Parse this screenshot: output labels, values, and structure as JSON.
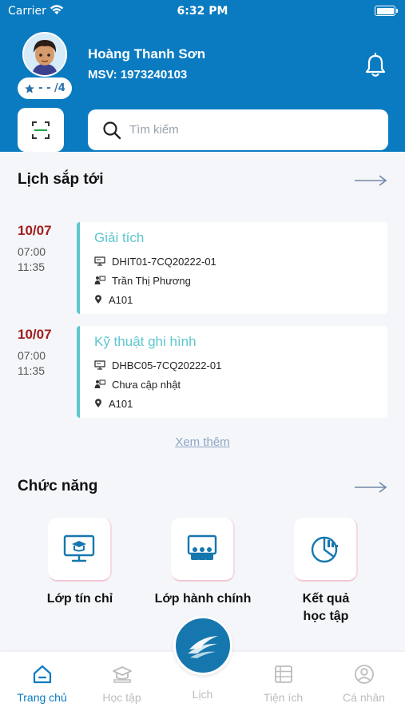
{
  "status_bar": {
    "carrier": "Carrier",
    "time": "6:32 PM"
  },
  "profile": {
    "name": "Hoàng Thanh Sơn",
    "student_id": "MSV: 1973240103",
    "rating": "- - /4"
  },
  "search": {
    "placeholder": "Tìm kiếm"
  },
  "schedule": {
    "title": "Lịch sắp tới",
    "see_more": "Xem thêm",
    "items": [
      {
        "date": "10/07",
        "start": "07:00",
        "end": "11:35",
        "subject": "Giải tích",
        "class_code": "DHIT01-7CQ20222-01",
        "teacher": "Trần Thị Phương",
        "room": "A101"
      },
      {
        "date": "10/07",
        "start": "07:00",
        "end": "11:35",
        "subject": "Kỹ thuật ghi hình",
        "class_code": "DHBC05-7CQ20222-01",
        "teacher": "Chưa cập nhật",
        "room": "A101"
      }
    ]
  },
  "features": {
    "title": "Chức năng",
    "items": [
      {
        "label": "Lớp tín chỉ",
        "icon": "monitor-graduation-icon"
      },
      {
        "label": "Lớp hành chính",
        "icon": "classroom-icon"
      },
      {
        "label": "Kết quả học tập",
        "icon": "pie-chart-icon"
      }
    ]
  },
  "tabs": [
    {
      "label": "Trang chủ",
      "icon": "home-icon",
      "active": true
    },
    {
      "label": "Học tập",
      "icon": "graduation-cap-icon",
      "active": false
    },
    {
      "label": "Lịch",
      "icon": "school-logo-icon",
      "active": false
    },
    {
      "label": "Tiện ích",
      "icon": "utilities-icon",
      "active": false
    },
    {
      "label": "Cá nhân",
      "icon": "user-icon",
      "active": false
    }
  ],
  "colors": {
    "primary": "#0b7bc1",
    "accent": "#5cc7cd",
    "date": "#a21e1e"
  }
}
